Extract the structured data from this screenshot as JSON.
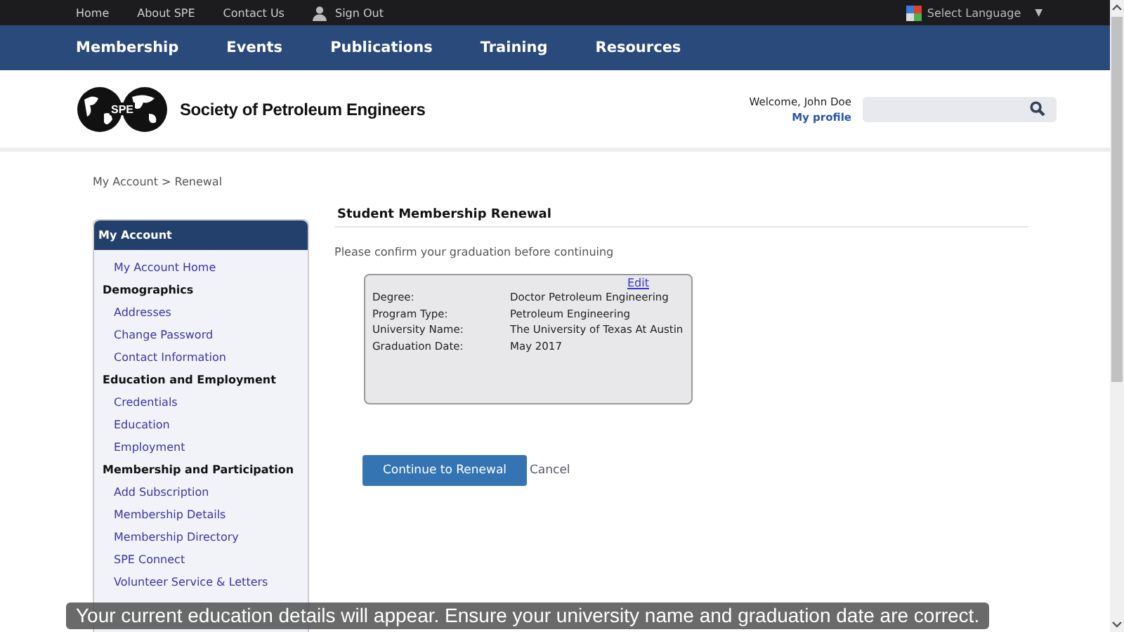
{
  "top_links": [
    {
      "label": "Home",
      "kind": "link"
    },
    {
      "label": "About SPE",
      "kind": "link"
    },
    {
      "label": "Contact Us",
      "kind": "link"
    },
    {
      "label": "Sign Out",
      "kind": "user"
    }
  ],
  "language": {
    "label": "Select Language",
    "arrow": "▼"
  },
  "nav": [
    "Membership",
    "Events",
    "Publications",
    "Training",
    "Resources"
  ],
  "header": {
    "site_name": "Society of Petroleum Engineers",
    "logo_text": "SPE",
    "welcome": "Welcome, John Doe",
    "profile_link": "My profile"
  },
  "breadcrumb": "My Account > Renewal",
  "sidebar": {
    "title": "My Account",
    "items": [
      {
        "label": "My Account Home",
        "kind": "link"
      },
      {
        "label": "Demographics",
        "kind": "heading"
      },
      {
        "label": "Addresses",
        "kind": "link"
      },
      {
        "label": "Change Password",
        "kind": "link"
      },
      {
        "label": "Contact Information",
        "kind": "link"
      },
      {
        "label": "Education and Employment",
        "kind": "heading"
      },
      {
        "label": "Credentials",
        "kind": "link"
      },
      {
        "label": "Education",
        "kind": "link"
      },
      {
        "label": "Employment",
        "kind": "link"
      },
      {
        "label": "Membership and Participation",
        "kind": "heading"
      },
      {
        "label": "Add Subscription",
        "kind": "link"
      },
      {
        "label": "Membership Details",
        "kind": "link"
      },
      {
        "label": "Membership Directory",
        "kind": "link"
      },
      {
        "label": "SPE Connect",
        "kind": "link"
      },
      {
        "label": "Volunteer Service & Letters",
        "kind": "link"
      }
    ]
  },
  "main": {
    "title": "Student Membership Renewal",
    "instruction": "Please confirm your graduation before continuing",
    "edit_link": "Edit",
    "details": [
      {
        "label": "Degree:",
        "value": "Doctor Petroleum Engineering"
      },
      {
        "label": "Program Type:",
        "value": "Petroleum Engineering"
      },
      {
        "label": "University Name:",
        "value": "The University of Texas At Austin"
      },
      {
        "label": "Graduation Date:",
        "value": "May 2017"
      }
    ],
    "primary_button": "Continue to Renewal",
    "cancel_link": "Cancel"
  },
  "caption": "Your current education details will appear. Ensure your university name and graduation date are correct."
}
